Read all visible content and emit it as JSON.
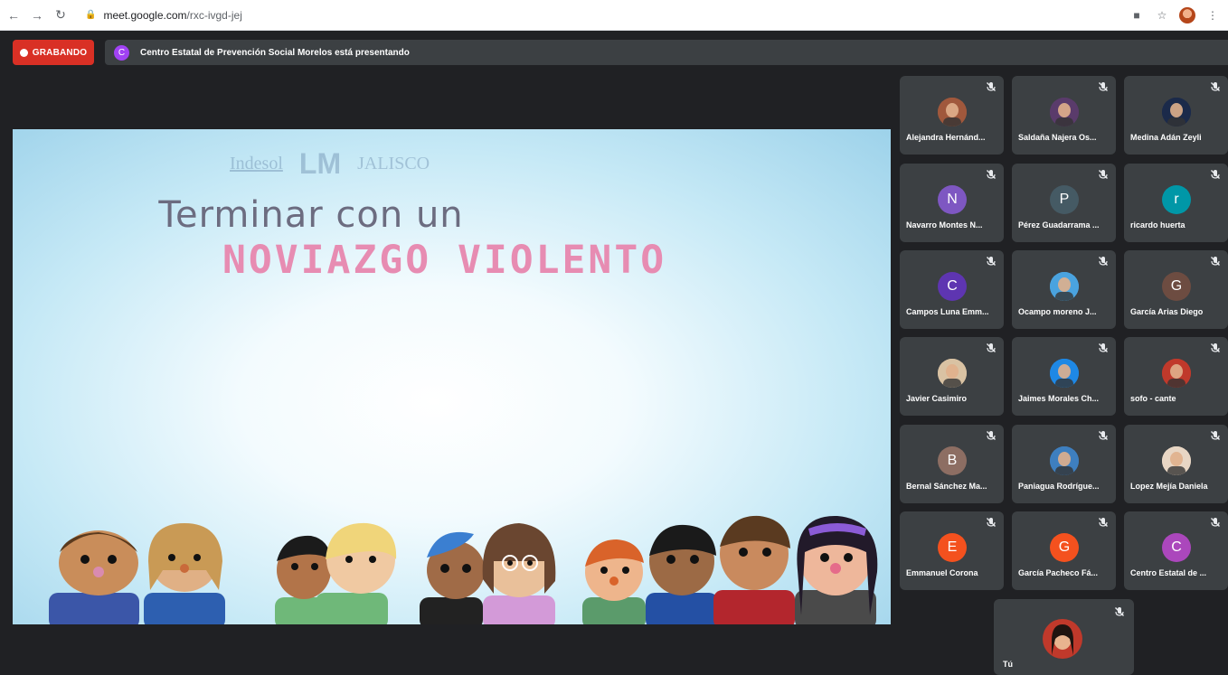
{
  "browser": {
    "back_icon": "arrow-left-icon",
    "forward_icon": "arrow-right-icon",
    "reload_icon": "reload-icon",
    "url_host": "meet.google.com",
    "url_path": "/rxc-ivgd-jej"
  },
  "meeting": {
    "recording_label": "GRABANDO",
    "recording_color": "#d93025",
    "presenter_initial": "C",
    "presenting_text": "Centro Estatal de Prevención Social Morelos está presentando"
  },
  "slide": {
    "logo_text_1": "Indesol",
    "logo_text_2": "LM",
    "logo_text_3": "JALISCO",
    "title_line1": "Terminar con un",
    "title_line2": "NOVIAZGO VIOLENTO"
  },
  "participants": [
    {
      "name": "Alejandra Hernánd...",
      "initial": "",
      "color": "#a0583c",
      "photo": true
    },
    {
      "name": "Saldaña Najera Os...",
      "initial": "",
      "color": "#5a3b6b",
      "photo": true
    },
    {
      "name": "Medina Adán Zeyli",
      "initial": "",
      "color": "#1b2a4a",
      "photo": true
    },
    {
      "name": "Navarro Montes N...",
      "initial": "N",
      "color": "#7e57c2",
      "photo": false
    },
    {
      "name": "Pérez Guadarrama ...",
      "initial": "P",
      "color": "#455a64",
      "photo": false
    },
    {
      "name": "ricardo huerta",
      "initial": "r",
      "color": "#0097a7",
      "photo": false
    },
    {
      "name": "Campos Luna Emm...",
      "initial": "C",
      "color": "#5e35b1",
      "photo": false
    },
    {
      "name": "Ocampo moreno J...",
      "initial": "",
      "color": "#4aa3df",
      "photo": true
    },
    {
      "name": "García Arias Diego",
      "initial": "G",
      "color": "#6d4c41",
      "photo": false
    },
    {
      "name": "Javier Casimiro",
      "initial": "",
      "color": "#d9c2a3",
      "photo": true
    },
    {
      "name": "Jaimes Morales Ch...",
      "initial": "",
      "color": "#1e88e5",
      "photo": true
    },
    {
      "name": "sofo - cante",
      "initial": "",
      "color": "#c0392b",
      "photo": true
    },
    {
      "name": "Bernal Sánchez Ma...",
      "initial": "B",
      "color": "#8d6e63",
      "photo": false
    },
    {
      "name": "Paniagua Rodrígue...",
      "initial": "",
      "color": "#3e7fbf",
      "photo": true
    },
    {
      "name": "Lopez Mejía Daniela",
      "initial": "",
      "color": "#e8d6c4",
      "photo": true
    },
    {
      "name": "Emmanuel Corona",
      "initial": "E",
      "color": "#f4511e",
      "photo": false
    },
    {
      "name": "García Pacheco Fá...",
      "initial": "G",
      "color": "#f4511e",
      "photo": false
    },
    {
      "name": "Centro Estatal de ...",
      "initial": "C",
      "color": "#ab47bc",
      "photo": false
    }
  ],
  "self": {
    "name": "Tú",
    "color": "#c0392b"
  },
  "icons": {
    "mic_off": "mic-off-icon"
  }
}
